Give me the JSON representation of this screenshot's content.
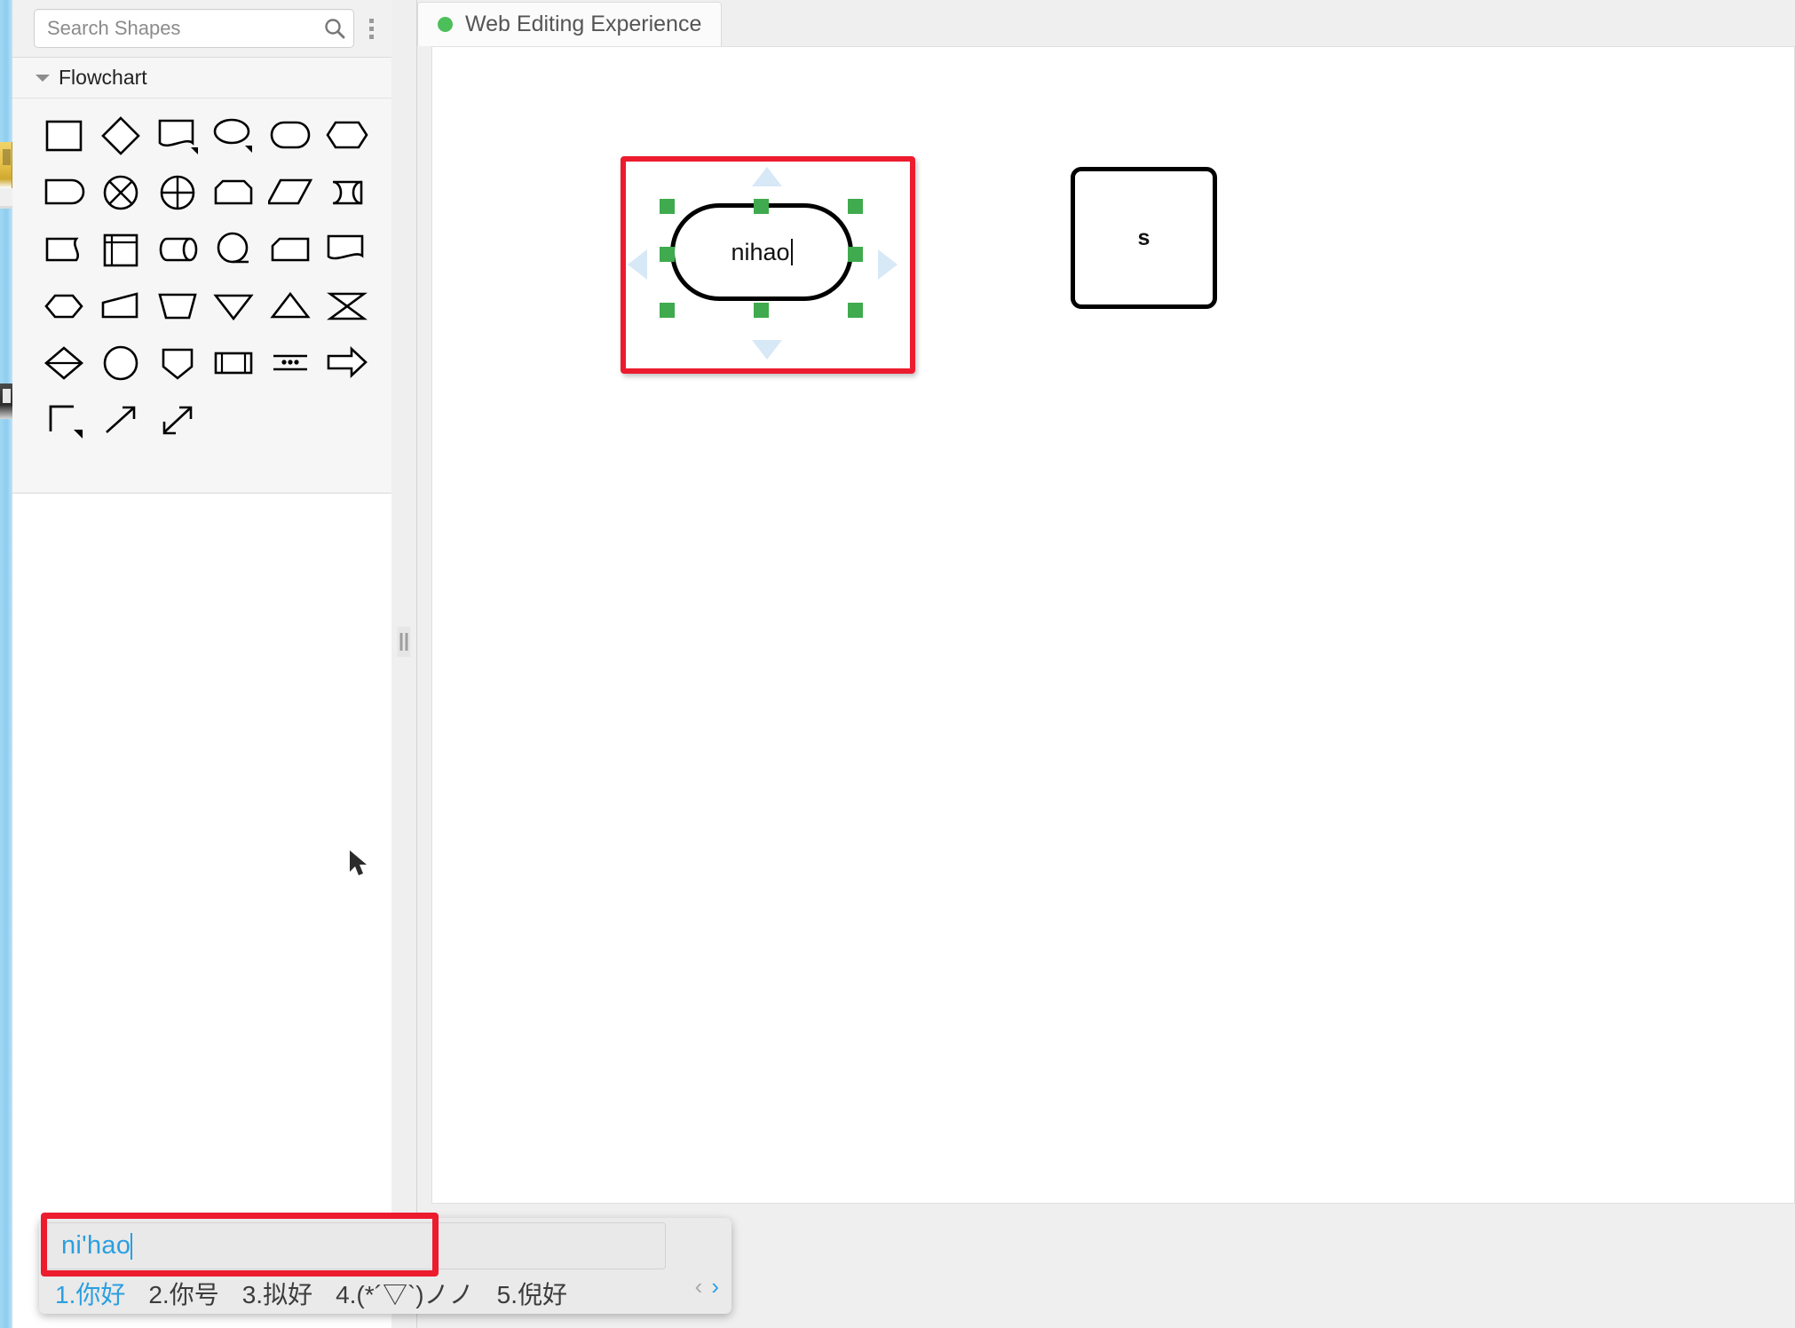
{
  "app": {
    "type": "diagram-editor",
    "canvas_background": "#ffffff"
  },
  "colors": {
    "accent_red": "#ec1b2e",
    "handle_green": "#3faa4e",
    "tab_dot_green": "#4cbf5a",
    "ime_blue": "#2b9fe0",
    "panel_bg": "#f6f6f6"
  },
  "search": {
    "placeholder": "Search Shapes",
    "value": "",
    "icon": "search-icon",
    "menu_icon": "kebab-menu-icon"
  },
  "library": {
    "section_title": "Flowchart",
    "collapse_icon": "chevron-down-icon",
    "shapes": [
      {
        "name": "process-rectangle",
        "icon": "rectangle-icon"
      },
      {
        "name": "decision-diamond",
        "icon": "diamond-icon"
      },
      {
        "name": "document",
        "icon": "document-icon"
      },
      {
        "name": "ellipse",
        "icon": "ellipse-icon"
      },
      {
        "name": "terminator-stadium",
        "icon": "stadium-icon"
      },
      {
        "name": "hexagon-flat",
        "icon": "hexagon-icon"
      },
      {
        "name": "delay",
        "icon": "delay-icon"
      },
      {
        "name": "summing-junction",
        "icon": "circle-x-icon"
      },
      {
        "name": "or-junction",
        "icon": "circle-plus-icon"
      },
      {
        "name": "loop-limit",
        "icon": "loop-limit-icon"
      },
      {
        "name": "data-parallelogram",
        "icon": "parallelogram-icon"
      },
      {
        "name": "stored-data",
        "icon": "cylinder-icon"
      },
      {
        "name": "direct-access-storage",
        "icon": "tape-icon"
      },
      {
        "name": "internal-storage",
        "icon": "internal-storage-icon"
      },
      {
        "name": "magnetic-drum",
        "icon": "drum-icon"
      },
      {
        "name": "sequential-access",
        "icon": "circle-tape-icon"
      },
      {
        "name": "card",
        "icon": "card-icon"
      },
      {
        "name": "multi-document",
        "icon": "multi-document-icon"
      },
      {
        "name": "collate",
        "icon": "lens-icon"
      },
      {
        "name": "manual-operation",
        "icon": "trapezoid-slanted-icon"
      },
      {
        "name": "manual-input",
        "icon": "trapezoid-down-icon"
      },
      {
        "name": "merge",
        "icon": "triangle-down-icon"
      },
      {
        "name": "extract",
        "icon": "triangle-up-icon"
      },
      {
        "name": "sort",
        "icon": "hourglass-icon"
      },
      {
        "name": "preparation-rhombus",
        "icon": "rhombus-split-icon"
      },
      {
        "name": "connector-circle",
        "icon": "circle-icon"
      },
      {
        "name": "off-page-connector",
        "icon": "pentagon-down-icon"
      },
      {
        "name": "predefined-process",
        "icon": "predefined-process-icon"
      },
      {
        "name": "annotation-dots",
        "icon": "dotted-lines-icon"
      },
      {
        "name": "arrow-block-right",
        "icon": "block-arrow-icon"
      },
      {
        "name": "bracket-connector",
        "icon": "bracket-icon"
      },
      {
        "name": "line-arrow",
        "icon": "line-arrow-icon"
      },
      {
        "name": "double-arrow",
        "icon": "double-arrow-icon"
      }
    ]
  },
  "splitter": {
    "name": "panel-splitter",
    "grip": "drag-handle-icon"
  },
  "tabs": [
    {
      "label": "Web Editing Experience",
      "status_dot": "#4cbf5a",
      "active": true
    }
  ],
  "canvas_objects": [
    {
      "name": "selected-rounded-rectangle",
      "shape": "rounded-rectangle",
      "text": "nihao",
      "editing": true,
      "selected": true,
      "highlight_color": "#ec1b2e",
      "handles": 8,
      "handle_color": "#3faa4e",
      "direction_arrows": [
        "up",
        "down",
        "left",
        "right"
      ]
    },
    {
      "name": "rounded-square-shape",
      "shape": "rounded-square",
      "text": "s",
      "editing": false,
      "selected": false
    }
  ],
  "ime": {
    "name": "chinese-ime-popup",
    "composition": "ni'hao",
    "highlighted": true,
    "candidates": [
      "1.你好",
      "2.你号",
      "3.拟好",
      "4.(*´▽`)ノノ",
      "5.倪好"
    ],
    "prev_label": "‹",
    "next_label": "›"
  }
}
